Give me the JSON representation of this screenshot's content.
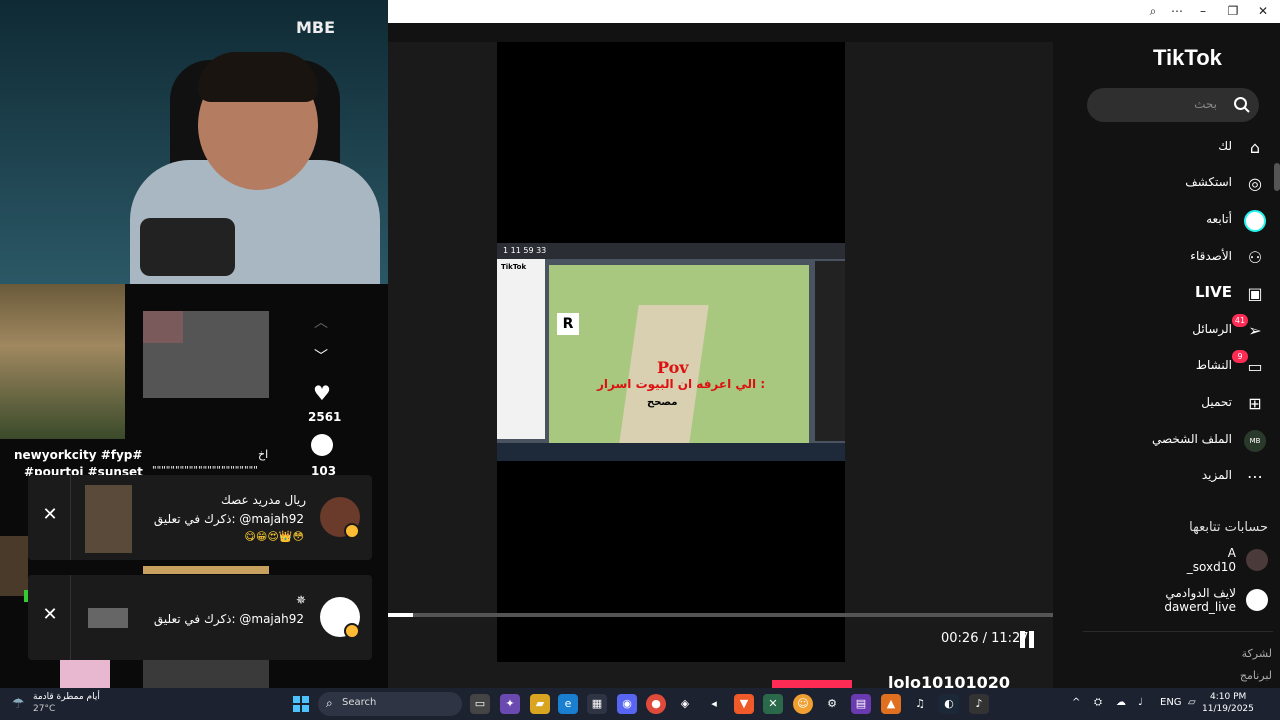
{
  "window": {
    "zoom_icon": "zoom-icon",
    "more_icon": "more-icon",
    "minimize": "–",
    "maximize": "❐",
    "close": "✕"
  },
  "sidebar": {
    "logo": "TikTok",
    "search_placeholder": "بحث",
    "nav": [
      {
        "label": "لك",
        "icon": "home-icon"
      },
      {
        "label": "استكشف",
        "icon": "compass-icon"
      },
      {
        "label": "أتابعه",
        "icon": "following-avatar-icon"
      },
      {
        "label": "الأصدقاء",
        "icon": "friends-icon"
      },
      {
        "label": "LIVE",
        "icon": "live-icon"
      },
      {
        "label": "الرسائل",
        "icon": "messages-icon",
        "badge": "41"
      },
      {
        "label": "النشاط",
        "icon": "activity-icon",
        "badge": "9"
      },
      {
        "label": "تحميل",
        "icon": "upload-icon"
      },
      {
        "label": "الملف الشخصي",
        "icon": "profile-avatar-icon"
      },
      {
        "label": "المزيد",
        "icon": "more-icon"
      }
    ],
    "following_title": "حسابات تتابعها",
    "following": [
      {
        "name": "A",
        "handle": "_soxd10"
      },
      {
        "name": "لايف الدوادمي",
        "handle": "dawerd_live"
      }
    ],
    "footer": [
      "لشركة",
      "لبرنامج"
    ]
  },
  "player": {
    "time": "00:26 / 11:27",
    "progress": 0.038,
    "video_text": {
      "timer": "1  11  59  33",
      "app": "TikTok",
      "game_letter": "R",
      "overlay_title": "Pov",
      "overlay_line": "الي اعرفه ان البيوت اسرار :",
      "overlay_sub": "مصحح"
    },
    "bottom_user": "lolo10101020"
  },
  "cam": {
    "logo": "MBE"
  },
  "feed": {
    "caption_left_1": "newyorkcity #fyp#",
    "caption_left_2": "#pourtoi #sunset",
    "caption_right_1": "اخ",
    "caption_right_2": "\"\"\"\"\"\"\"\"\"\"\"\"\"\"\"\"\"\"\"\"\"\"\"",
    "likes": "2561",
    "comments": "103"
  },
  "notifications": [
    {
      "title": "ريال مدريد عصك",
      "text": "ذكرك في تعليق: @majah92",
      "emoji": "😋😁😍👑😳"
    },
    {
      "title": "✵",
      "text": "ذكرك في تعليق: @majah92",
      "emoji": ""
    }
  ],
  "taskbar": {
    "weather_text": "أيام ممطرة قادمة",
    "weather_temp": "27°C",
    "search_label": "Search",
    "lang": "ENG",
    "time": "4:10 PM",
    "date": "11/19/2025"
  },
  "colors": {
    "accent": "#fe2c55",
    "badge": "#fe2c55",
    "win_blue": "#4cc2ff"
  }
}
